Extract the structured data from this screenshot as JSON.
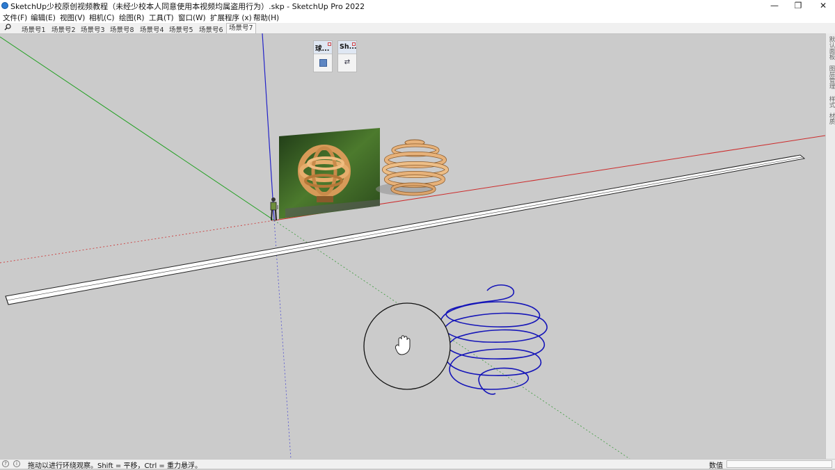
{
  "window": {
    "title": "SketchUp少校原创视频教程（未经少校本人同意使用本视频均属盗用行为）.skp - SketchUp Pro 2022",
    "minimize_glyph": "—",
    "maximize_glyph": "❐",
    "close_glyph": "✕"
  },
  "menu": [
    {
      "label": "文件(F)"
    },
    {
      "label": "编辑(E)"
    },
    {
      "label": "视图(V)"
    },
    {
      "label": "相机(C)"
    },
    {
      "label": "绘图(R)"
    },
    {
      "label": "工具(T)"
    },
    {
      "label": "窗口(W)"
    },
    {
      "label": "扩展程序 (x)"
    },
    {
      "label": "帮助(H)"
    }
  ],
  "scenes": {
    "search_icon": "search-icon",
    "tabs": [
      {
        "label": "场景号1"
      },
      {
        "label": "场景号2"
      },
      {
        "label": "场景号3"
      },
      {
        "label": "场景号8"
      },
      {
        "label": "场景号4"
      },
      {
        "label": "场景号5"
      },
      {
        "label": "场景号6"
      },
      {
        "label": "场景号7",
        "active": true
      }
    ]
  },
  "floating_toolbars": [
    {
      "title": "球...",
      "button_icon": "plugin-icon"
    },
    {
      "title": "Sh...",
      "button_glyph": "⇄",
      "button_icon": "swap-icon"
    }
  ],
  "tray_tabs": [
    {
      "label": "默认面板"
    },
    {
      "label": "图层管理"
    },
    {
      "label": "样式"
    },
    {
      "label": "材质"
    }
  ],
  "status": {
    "text": "拖动以进行环绕观察。Shift = 平移，Ctrl = 重力悬浮。",
    "measurements_label": "数值",
    "measurements_value": ""
  },
  "colors": {
    "viewport_background": "#cbcbcb",
    "axis_red": "#cc2a2a",
    "axis_green": "#22a022",
    "axis_blue": "#2323c8",
    "helix_blue": "#1515b8",
    "wood": "#e7b27a"
  }
}
